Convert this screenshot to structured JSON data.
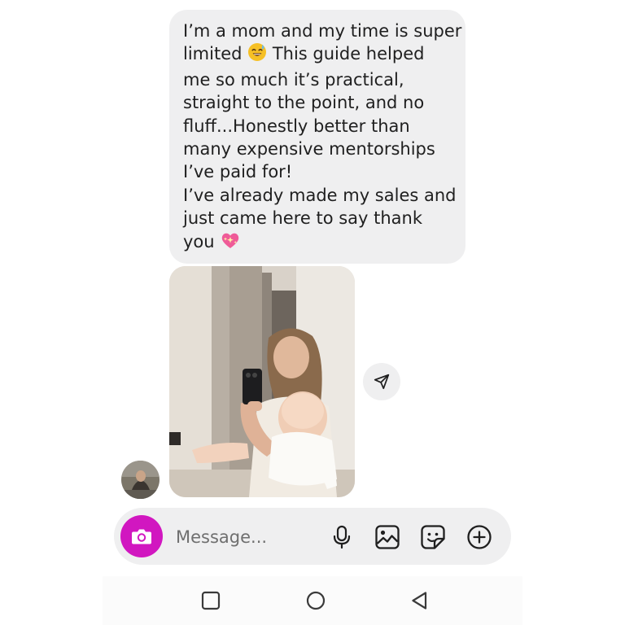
{
  "message": {
    "lines": [
      {
        "text": "I’m a mom and my time is super"
      },
      {
        "text": "limited",
        "emoji": "sweat-smile-emoji",
        "after": " This guide helped"
      },
      {
        "text": "me so much it’s practical,"
      },
      {
        "text": "straight to the point, and no"
      },
      {
        "text": "fluff...Honestly better than"
      },
      {
        "text": "many expensive mentorships"
      },
      {
        "text": "I’ve paid for!"
      },
      {
        "text": "I’ve already made my sales and"
      },
      {
        "text": "just came here to say thank"
      },
      {
        "text": "you",
        "emoji": "sparkling-heart-emoji",
        "after": ""
      }
    ]
  },
  "composer": {
    "placeholder": "Message...",
    "tools": [
      "microphone-icon",
      "gallery-icon",
      "sticker-icon",
      "add-icon"
    ]
  },
  "colors": {
    "bubble": "#efeff0",
    "accent": "#d117c0",
    "text": "#1f1f1f",
    "placeholder": "#6f6f6f"
  }
}
